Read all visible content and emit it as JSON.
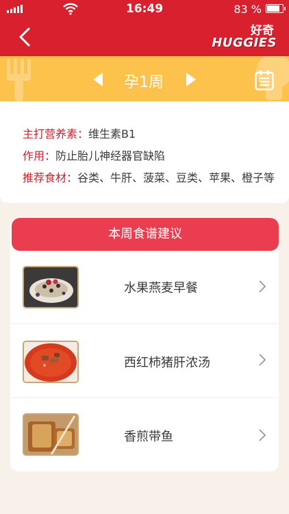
{
  "status_bar": {
    "time": "16:49",
    "battery_text": "83 %",
    "battery_level": 0.83
  },
  "nav": {
    "back_icon": "chevron-left-icon",
    "logo_cn": "好奇",
    "logo_en": "HUGGIES"
  },
  "week": {
    "label": "孕1周",
    "prev_icon": "triangle-left-icon",
    "next_icon": "triangle-right-icon",
    "calendar_icon": "calendar-icon"
  },
  "info": {
    "nutrient_label": "主打营养素：",
    "nutrient_value": "维生素B1",
    "effect_label": "作用：",
    "effect_value": "防止胎儿神经器官缺陷",
    "food_label": "推荐食材：",
    "food_value": "谷类、牛肝、菠菜、豆类、苹果、橙子等"
  },
  "recipes": {
    "header": "本周食谱建议",
    "items": [
      {
        "name": "水果燕麦早餐"
      },
      {
        "name": "西红柿猪肝浓汤"
      },
      {
        "name": "香煎带鱼"
      }
    ]
  },
  "colors": {
    "brand_red": "#d8202f",
    "yellow": "#fcc24c",
    "header_red": "#ea3d4f"
  }
}
